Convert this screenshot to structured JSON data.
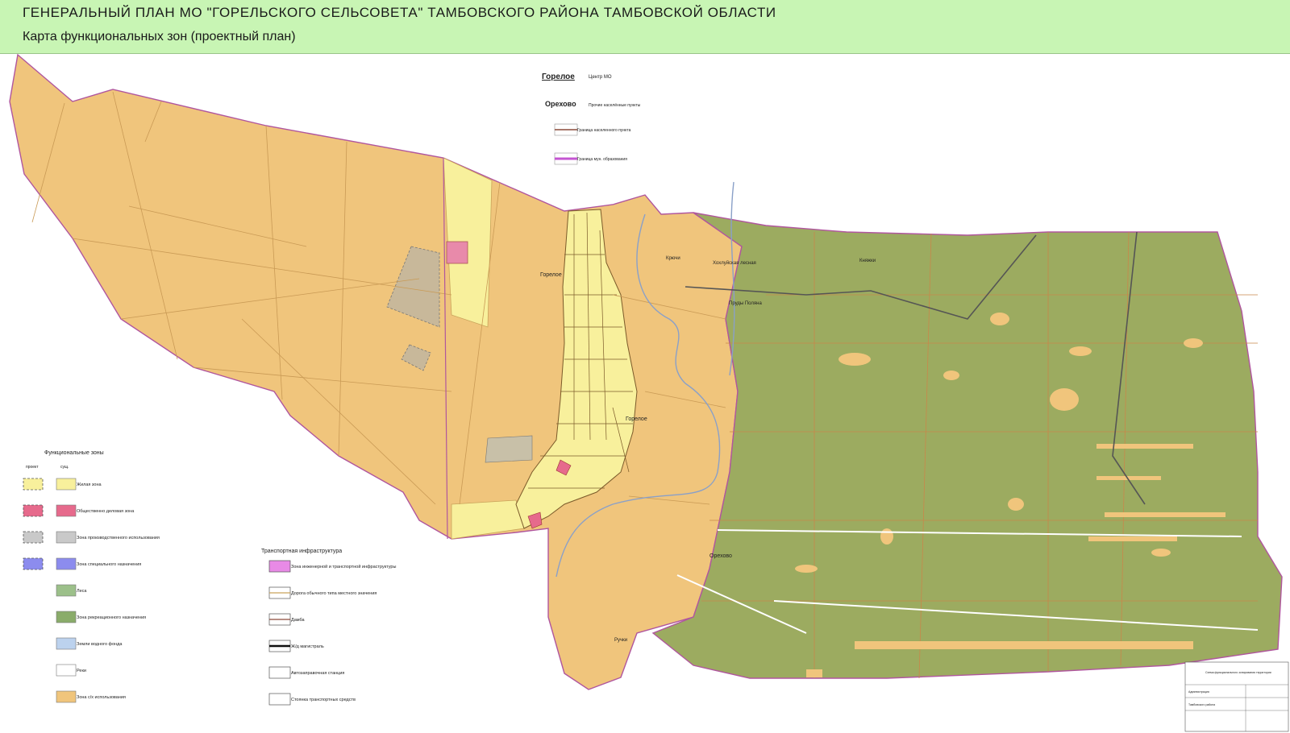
{
  "header": {
    "title": "ГЕНЕРАЛЬНЫЙ ПЛАН МО \"ГОРЕЛЬСКОГО  СЕЛЬСОВЕТА\"  ТАМБОВСКОГО  РАЙОНА   ТАМБОВСКОЙ ОБЛАСТИ",
    "subtitle": "Карта функциональных зон (проектный план)"
  },
  "colors": {
    "header_bg": "#c8f5b4",
    "agri": "#f0c57c",
    "forest": "#9cab60",
    "residential": "#f8f09c",
    "public": "#e66a8c",
    "industrial": "#c8b89a",
    "boundary": "#c455d2"
  },
  "top_legend": {
    "center_name": "Горелое",
    "center_desc": "Центр МО",
    "other_name": "Орехово",
    "other_desc": "Прочие населённые пункты",
    "settlement_border": "Граница населенного пункта",
    "municipal_border": "Граница мун. образования"
  },
  "zones_legend": {
    "title": "Функциональные зоны",
    "col_project": "проект",
    "col_existing": "сущ.",
    "items": [
      {
        "label": "Жилая зона",
        "color": "#f8f09c",
        "project": true
      },
      {
        "label": "Общественно деловая зона",
        "color": "#e66a8c",
        "project": true
      },
      {
        "label": "Зона производственного использования",
        "color": "#c9c9c9",
        "project": true
      },
      {
        "label": "Зона специального назначения",
        "color": "#8c8cee",
        "project": true
      },
      {
        "label": "Леса",
        "color": "#9cc08a",
        "project": false
      },
      {
        "label": "Зона рекреационного назначения",
        "color": "#8aac6a",
        "project": false
      },
      {
        "label": "Земли водного фонда",
        "color": "#bcd2ee",
        "project": false
      },
      {
        "label": "Реки",
        "color": "#ffffff",
        "project": false
      },
      {
        "label": "Зона с/х использования",
        "color": "#f0c57c",
        "project": false
      }
    ]
  },
  "transport_legend": {
    "title": "Транспортная инфраструктура",
    "items": [
      {
        "label": "Зона инженерной и транспортной инфраструктуры"
      },
      {
        "label": "Дорога обычного типа местного значения"
      },
      {
        "label": "Дамба"
      },
      {
        "label": "Ж/д магистраль"
      },
      {
        "label": "Автозаправочная станция"
      },
      {
        "label": "Стоянка транспортных средств"
      }
    ]
  },
  "place_labels": {
    "gorelye_north": "Горелое",
    "gorelye_south": "Горелое",
    "kriachi": "Крючи",
    "khokhluvka": "Хохлуйская лесная",
    "knyazhki": "Княжки",
    "prudki": "Пруды Поляна",
    "orekhovo": "Орехово",
    "ruchki": "Ручки"
  },
  "stamp": {
    "header": "Схема функционального зонирования территории",
    "row1": "Администрация",
    "row2": "Тамбовского района"
  }
}
